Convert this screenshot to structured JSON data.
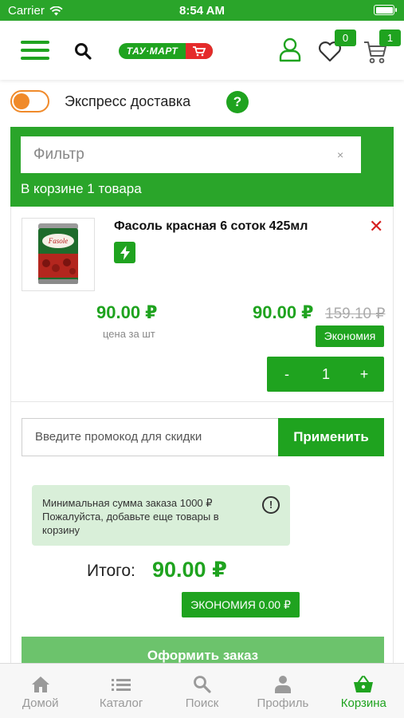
{
  "status_bar": {
    "carrier": "Carrier",
    "time": "8:54 AM"
  },
  "header": {
    "logo_text": "ТАУ·МАРТ",
    "favorites_count": "0",
    "cart_count": "1"
  },
  "express": {
    "label": "Экспресс доставка",
    "help": "?",
    "enabled": false
  },
  "filter": {
    "placeholder": "Фильтр",
    "clear": "×",
    "cart_summary": "В корзине 1 товара"
  },
  "product": {
    "name": "Фасоль красная 6 соток 425мл",
    "unit_price": "90.00 ₽",
    "unit_label": "цена за шт",
    "total_price": "90.00 ₽",
    "old_price": "159.10 ₽",
    "economy_label": "Экономия",
    "quantity": "1",
    "minus": "-",
    "plus": "+",
    "remove": "✕"
  },
  "promo": {
    "placeholder": "Введите промокод для скидки",
    "apply_label": "Применить"
  },
  "notice": {
    "line1": "Минимальная сумма заказа 1000 ₽",
    "line2": "Пожалуйста, добавьте еще товары в корзину",
    "icon": "!"
  },
  "totals": {
    "label": "Итого:",
    "value": "90.00 ₽",
    "economy": "ЭКОНОМИЯ 0.00 ₽"
  },
  "order_button": "Оформить заказ",
  "tabs": [
    {
      "label": "Домой",
      "icon": "home-icon"
    },
    {
      "label": "Каталог",
      "icon": "list-icon"
    },
    {
      "label": "Поиск",
      "icon": "search-icon"
    },
    {
      "label": "Профиль",
      "icon": "person-icon"
    },
    {
      "label": "Корзина",
      "icon": "basket-icon",
      "active": true
    }
  ],
  "colors": {
    "brand_green": "#1fa31f",
    "status_green": "#2aa52a",
    "accent_orange": "#f08a2a",
    "remove_red": "#d61f1f",
    "notice_bg": "#d9efd9"
  }
}
